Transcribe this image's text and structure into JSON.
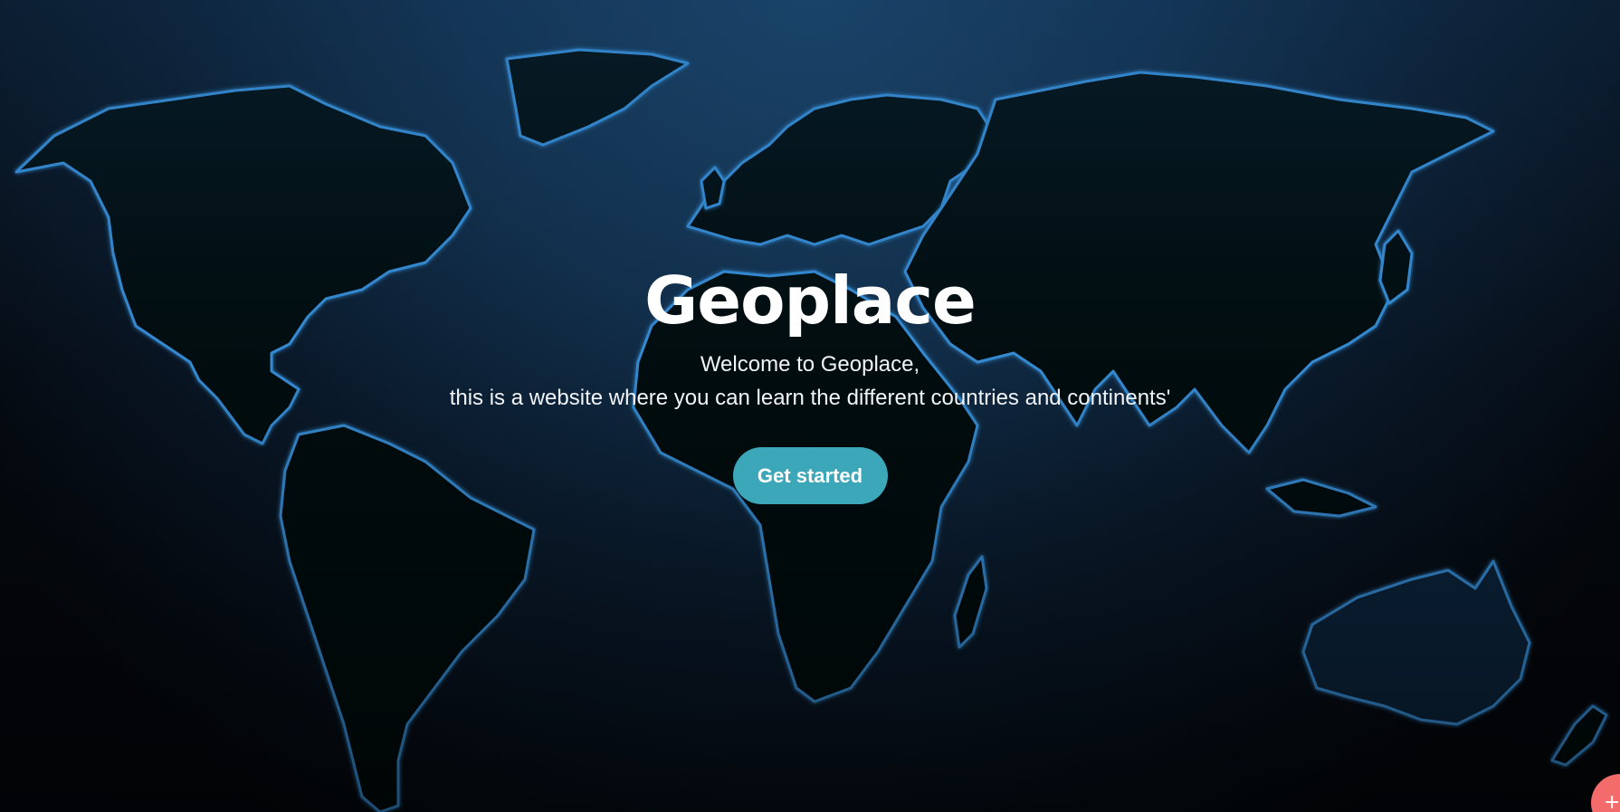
{
  "hero": {
    "title": "Geoplace",
    "subtitle_line1": "Welcome to Geoplace,",
    "subtitle_line2": "this is a website where you can learn the different countries and continents'",
    "cta_label": "Get started",
    "background": "world-map-background",
    "accent_color": "#3ba7b9",
    "outline_color": "#3fa9ff"
  },
  "corner_button": {
    "label": "+",
    "color": "#f36b6b"
  }
}
